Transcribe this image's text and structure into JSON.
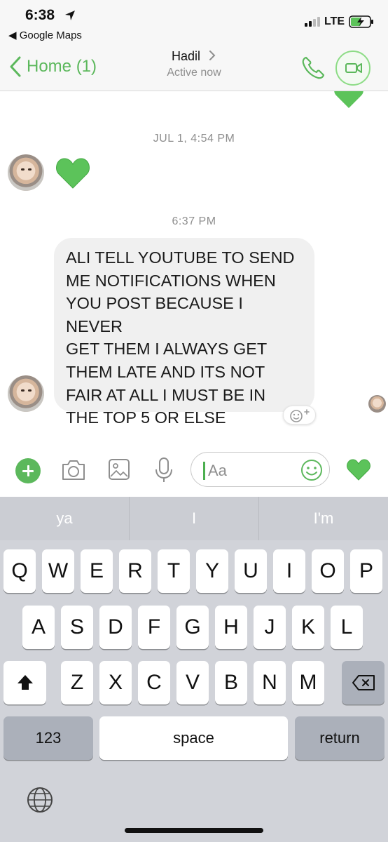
{
  "status_bar": {
    "time": "6:38",
    "back_app": "◀ Google Maps",
    "network": "LTE"
  },
  "header": {
    "back_label": "Home (1)",
    "contact_name": "Hadil",
    "contact_status": "Active now",
    "icons": [
      "chevron-left-icon",
      "chevron-right-icon",
      "phone-icon",
      "video-camera-icon"
    ]
  },
  "thread": {
    "timestamp_1": "JUL 1, 4:54 PM",
    "timestamp_2": "6:37 PM",
    "message": "ALI TELL YOUTUBE TO SEND\nME NOTIFICATIONS WHEN\nYOU POST BECAUSE I NEVER\nGET THEM I ALWAYS GET\nTHEM LATE AND ITS NOT\nFAIR AT ALL I MUST BE IN\nTHE TOP 5 OR ELSE",
    "heart_color": "#5cc35a"
  },
  "composer": {
    "placeholder": "Aa",
    "icons": [
      "plus-icon",
      "camera-icon",
      "image-icon",
      "microphone-icon",
      "smiley-icon",
      "heart-icon"
    ]
  },
  "keyboard": {
    "suggestions": [
      "ya",
      "I",
      "I'm"
    ],
    "row1": [
      "Q",
      "W",
      "E",
      "R",
      "T",
      "Y",
      "U",
      "I",
      "O",
      "P"
    ],
    "row2": [
      "A",
      "S",
      "D",
      "F",
      "G",
      "H",
      "J",
      "K",
      "L"
    ],
    "row3": [
      "Z",
      "X",
      "C",
      "V",
      "B",
      "N",
      "M"
    ],
    "numbers_label": "123",
    "space_label": "space",
    "return_label": "return"
  },
  "colors": {
    "accent": "#5cb85c",
    "bubble": "#f0f0f0",
    "keyboard_bg": "#d1d3d9"
  }
}
